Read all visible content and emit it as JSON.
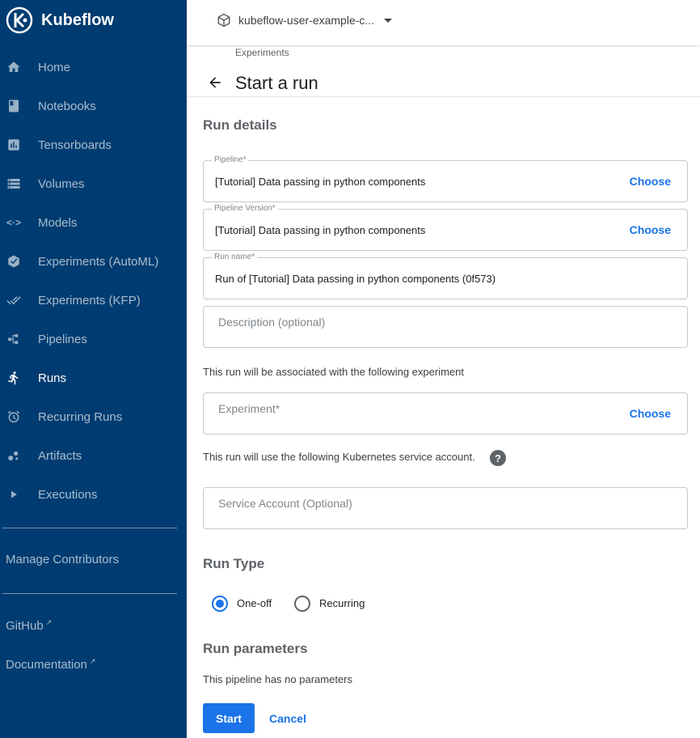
{
  "app": {
    "name": "Kubeflow"
  },
  "sidebar": {
    "items": [
      {
        "label": "Home",
        "icon": "home-icon"
      },
      {
        "label": "Notebooks",
        "icon": "notebook-icon"
      },
      {
        "label": "Tensorboards",
        "icon": "chart-icon"
      },
      {
        "label": "Volumes",
        "icon": "storage-icon"
      },
      {
        "label": "Models",
        "icon": "code-arrows-icon"
      },
      {
        "label": "Experiments (AutoML)",
        "icon": "automl-icon"
      },
      {
        "label": "Experiments (KFP)",
        "icon": "done-all-icon"
      },
      {
        "label": "Pipelines",
        "icon": "pipeline-icon"
      },
      {
        "label": "Runs",
        "icon": "run-icon",
        "active": true
      },
      {
        "label": "Recurring Runs",
        "icon": "alarm-icon"
      },
      {
        "label": "Artifacts",
        "icon": "bubble-icon"
      },
      {
        "label": "Executions",
        "icon": "play-icon"
      }
    ],
    "manage_contributors": "Manage Contributors",
    "github": "GitHub",
    "documentation": "Documentation"
  },
  "header": {
    "namespace": "kubeflow-user-example-c..."
  },
  "page": {
    "breadcrumb": "Experiments",
    "title": "Start a run"
  },
  "run_details": {
    "heading": "Run details",
    "pipeline": {
      "legend": "Pipeline*",
      "value": "[Tutorial] Data passing in python components",
      "action": "Choose"
    },
    "pipeline_version": {
      "legend": "Pipeline Version*",
      "value": "[Tutorial] Data passing in python components",
      "action": "Choose"
    },
    "run_name": {
      "legend": "Run name*",
      "value": "Run of [Tutorial] Data passing in python components (0f573)"
    },
    "description": {
      "placeholder": "Description (optional)"
    },
    "experiment_note": "This run will be associated with the following experiment",
    "experiment": {
      "placeholder": "Experiment*",
      "action": "Choose"
    },
    "service_account_note": "This run will use the following Kubernetes service account.",
    "help_glyph": "?",
    "service_account": {
      "placeholder": "Service Account (Optional)"
    }
  },
  "run_type": {
    "heading": "Run Type",
    "options": [
      {
        "label": "One-off",
        "selected": true
      },
      {
        "label": "Recurring",
        "selected": false
      }
    ]
  },
  "run_parameters": {
    "heading": "Run parameters",
    "note": "This pipeline has no parameters"
  },
  "actions": {
    "start": "Start",
    "cancel": "Cancel"
  },
  "colors": {
    "sidebar_bg": "#003c71",
    "accent": "#1a73e8"
  }
}
